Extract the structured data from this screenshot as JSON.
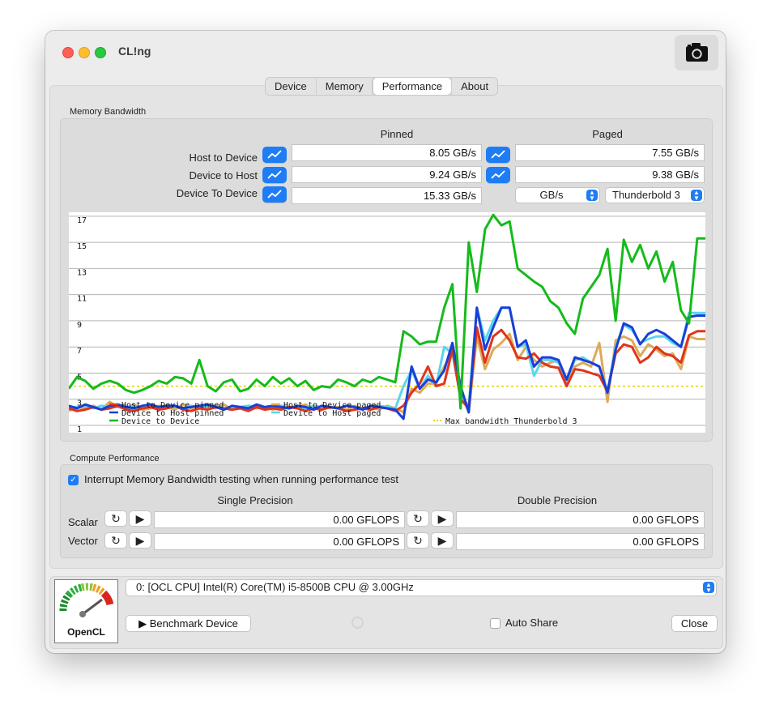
{
  "app": {
    "title": "CL!ng"
  },
  "tabs": [
    {
      "label": "Device",
      "selected": false
    },
    {
      "label": "Memory",
      "selected": false
    },
    {
      "label": "Performance",
      "selected": true
    },
    {
      "label": "About",
      "selected": false
    }
  ],
  "memory": {
    "section_label": "Memory Bandwidth",
    "col_pinned": "Pinned",
    "col_paged": "Paged",
    "rows": [
      {
        "label": "Host to Device",
        "pinned": "8.05 GB/s",
        "paged": "7.55 GB/s"
      },
      {
        "label": "Device to Host",
        "pinned": "9.24 GB/s",
        "paged": "9.38 GB/s"
      },
      {
        "label": "Device To Device",
        "pinned": "15.33 GB/s"
      }
    ],
    "unit_popup": "GB/s",
    "interface_popup": "Thunderbold 3",
    "graph_icon": "line-chart-icon"
  },
  "chart_data": {
    "type": "line",
    "y_ticks": [
      "1",
      "3",
      "5",
      "7",
      "9",
      "11",
      "13",
      "15",
      "17"
    ],
    "ylim": [
      1,
      17.3
    ],
    "grid": true,
    "legend_position": "bottom-left",
    "reference_line": {
      "name": "Max bandwidth Thunderbold 3",
      "value": 4.0,
      "color": "#e8d400"
    },
    "series": [
      {
        "name": "Host to Device pinned",
        "color": "#e0341a",
        "values": [
          2.3,
          2.1,
          2.2,
          2.4,
          2.2,
          2.3,
          2.5,
          2.2,
          2.1,
          2.3,
          2.4,
          2.2,
          2.3,
          2.5,
          2.2,
          2.1,
          2.3,
          2.2,
          2.4,
          2.3,
          2.2,
          2.3,
          2.1,
          2.4,
          2.2,
          2.3,
          2.2,
          2.4,
          2.3,
          2.1,
          2.3,
          2.2,
          2.4,
          2.3,
          2.1,
          2.2,
          2.3,
          2.2,
          2.4,
          2.3,
          2.1,
          2.5,
          3.5,
          4.2,
          5.5,
          4.0,
          4.2,
          6.8,
          3.0,
          2.3,
          8.5,
          5.8,
          7.8,
          8.3,
          7.5,
          6.2,
          6.1,
          6.5,
          5.8,
          5.5,
          5.4,
          4.0,
          5.3,
          5.2,
          5.0,
          4.8,
          3.6,
          6.5,
          7.2,
          7.0,
          5.8,
          6.2,
          7.0,
          6.5,
          6.3,
          5.8,
          7.9,
          8.2,
          8.2
        ]
      },
      {
        "name": "Device to Host pinned",
        "color": "#1a3fd6",
        "values": [
          2.5,
          2.3,
          2.6,
          2.4,
          2.2,
          2.5,
          2.6,
          2.4,
          2.3,
          2.5,
          2.6,
          2.4,
          2.5,
          2.5,
          2.3,
          2.4,
          2.5,
          2.6,
          2.4,
          2.2,
          2.5,
          2.4,
          2.3,
          2.6,
          2.4,
          2.5,
          2.4,
          2.3,
          2.5,
          2.4,
          2.2,
          2.5,
          2.4,
          2.3,
          2.5,
          2.4,
          2.2,
          2.5,
          2.4,
          2.3,
          2.2,
          1.5,
          5.5,
          3.8,
          4.5,
          4.3,
          5.2,
          7.3,
          4.0,
          2.0,
          10.0,
          6.8,
          8.5,
          10.0,
          10.0,
          7.0,
          7.5,
          5.5,
          6.2,
          6.2,
          6.0,
          4.5,
          6.2,
          6.0,
          5.8,
          5.5,
          3.5,
          6.8,
          8.8,
          8.5,
          7.2,
          8.0,
          8.3,
          8.0,
          7.5,
          7.0,
          9.3,
          9.4,
          9.4
        ]
      },
      {
        "name": "Device to Device",
        "color": "#15bb1a",
        "values": [
          3.8,
          4.7,
          4.4,
          3.8,
          4.2,
          4.4,
          4.2,
          3.7,
          3.5,
          3.7,
          4.0,
          4.4,
          4.2,
          4.7,
          4.6,
          4.2,
          6.0,
          4.0,
          3.6,
          4.3,
          4.5,
          3.6,
          3.8,
          4.5,
          4.0,
          4.7,
          4.2,
          4.6,
          4.0,
          4.4,
          3.7,
          4.0,
          3.9,
          4.5,
          4.3,
          4.0,
          4.5,
          4.3,
          4.7,
          4.5,
          4.3,
          8.2,
          7.8,
          7.2,
          7.4,
          7.4,
          10.0,
          11.8,
          2.3,
          15.0,
          11.2,
          16.0,
          17.1,
          16.3,
          16.6,
          13.0,
          12.5,
          12.0,
          11.6,
          10.5,
          10.0,
          8.8,
          8.0,
          10.7,
          11.6,
          12.5,
          14.5,
          9.0,
          15.2,
          13.5,
          14.8,
          13.0,
          14.3,
          12.0,
          13.5,
          9.8,
          8.8,
          15.3,
          15.3
        ]
      },
      {
        "name": "Host to Device paged",
        "color": "#dcaa5b",
        "values": [
          2.1,
          2.4,
          2.3,
          2.5,
          2.2,
          2.8,
          2.4,
          2.3,
          2.6,
          2.2,
          2.3,
          2.5,
          2.4,
          2.2,
          2.6,
          2.3,
          2.5,
          2.4,
          2.3,
          2.6,
          2.2,
          2.4,
          2.5,
          2.3,
          2.4,
          2.2,
          2.5,
          2.3,
          2.4,
          2.6,
          2.2,
          2.5,
          2.3,
          2.4,
          2.2,
          2.5,
          2.3,
          2.4,
          2.2,
          2.5,
          2.3,
          2.0,
          3.8,
          3.5,
          4.2,
          4.2,
          5.5,
          6.5,
          3.5,
          2.0,
          7.8,
          5.3,
          6.8,
          7.3,
          8.0,
          6.0,
          7.0,
          6.0,
          5.5,
          5.8,
          6.0,
          4.2,
          5.5,
          5.8,
          5.5,
          7.3,
          2.8,
          7.5,
          7.8,
          7.5,
          6.3,
          7.2,
          6.8,
          6.3,
          6.5,
          5.3,
          7.8,
          7.6,
          7.6
        ]
      },
      {
        "name": "Device to Host paged",
        "color": "#5ad5ee",
        "values": [
          2.4,
          2.4,
          2.5,
          2.3,
          2.5,
          2.4,
          2.4,
          2.4,
          2.5,
          2.3,
          2.4,
          2.4,
          2.5,
          2.4,
          2.3,
          2.5,
          2.4,
          2.4,
          2.5,
          2.3,
          2.4,
          2.4,
          2.5,
          2.4,
          2.3,
          2.4,
          2.5,
          2.4,
          2.4,
          2.3,
          2.5,
          2.4,
          2.4,
          2.3,
          2.5,
          2.4,
          2.3,
          2.4,
          2.5,
          2.4,
          2.3,
          4.0,
          5.2,
          3.8,
          4.8,
          4.0,
          7.0,
          6.5,
          3.2,
          2.5,
          10.0,
          7.5,
          9.0,
          10.0,
          10.0,
          7.0,
          7.2,
          4.8,
          6.0,
          6.0,
          5.8,
          4.5,
          6.0,
          6.2,
          5.8,
          5.5,
          3.6,
          7.0,
          8.7,
          8.3,
          7.3,
          7.6,
          7.8,
          7.8,
          7.3,
          7.0,
          9.6,
          9.6,
          9.6
        ]
      }
    ]
  },
  "compute": {
    "section_label": "Compute Performance",
    "interrupt_label": "Interrupt Memory Bandwidth testing when running performance test",
    "interrupt_checked": true,
    "col_single": "Single Precision",
    "col_double": "Double Precision",
    "rows": [
      {
        "label": "Scalar",
        "single": "0.00 GFLOPS",
        "double": "0.00 GFLOPS"
      },
      {
        "label": "Vector",
        "single": "0.00 GFLOPS",
        "double": "0.00 GFLOPS"
      }
    ]
  },
  "footer": {
    "logo_label": "OpenCL",
    "device_select": "0: [OCL CPU] Intel(R) Core(TM) i5-8500B CPU @ 3.00GHz",
    "benchmark_label": "Benchmark Device",
    "auto_share_label": "Auto Share",
    "auto_share_checked": false,
    "close_label": "Close"
  }
}
